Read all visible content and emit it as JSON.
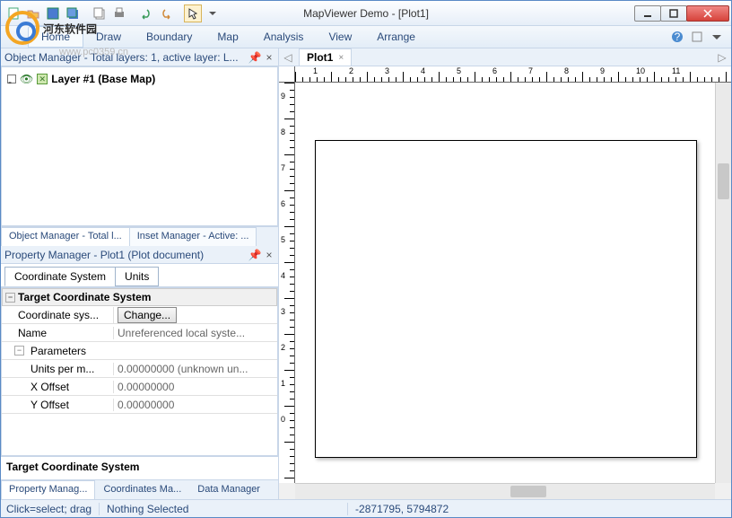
{
  "title": "MapViewer Demo - [Plot1]",
  "watermark": {
    "text": "河东软件园",
    "url": "www.pc0359.cn"
  },
  "menu": {
    "home": "Home",
    "draw": "Draw",
    "boundary": "Boundary",
    "map": "Map",
    "analysis": "Analysis",
    "view": "View",
    "arrange": "Arrange"
  },
  "objectManager": {
    "title": "Object Manager - Total layers: 1, active layer: L...",
    "tab1": "Object Manager - Total l...",
    "tab2": "Inset Manager - Active: ...",
    "layer": "Layer #1 (Base Map)"
  },
  "propertyManager": {
    "title": "Property Manager - Plot1 (Plot document)",
    "tab_coord": "Coordinate System",
    "tab_units": "Units",
    "section": "Target Coordinate System",
    "rows": {
      "coord_sys_label": "Coordinate sys...",
      "change_btn": "Change...",
      "name_label": "Name",
      "name_value": "Unreferenced local syste...",
      "params_label": "Parameters",
      "units_label": "Units per m...",
      "units_value": "0.00000000 (unknown un...",
      "xoff_label": "X Offset",
      "xoff_value": "0.00000000",
      "yoff_label": "Y Offset",
      "yoff_value": "0.00000000"
    },
    "desc": "Target Coordinate System",
    "btab1": "Property Manag...",
    "btab2": "Coordinates Ma...",
    "btab3": "Data Manager"
  },
  "docTab": "Plot1",
  "rulerH": [
    "1",
    "2",
    "3",
    "4",
    "5",
    "6",
    "7",
    "8",
    "9",
    "10",
    "11"
  ],
  "rulerV": [
    "9",
    "8",
    "7",
    "6",
    "5",
    "4",
    "3",
    "2",
    "1",
    "0"
  ],
  "status": {
    "hint": "Click=select; drag",
    "sel": "Nothing Selected",
    "coords": "-2871795, 5794872"
  }
}
